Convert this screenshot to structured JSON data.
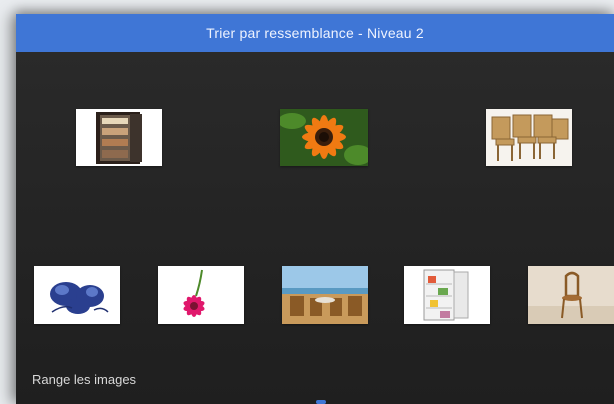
{
  "window": {
    "title": "Trier par ressemblance - Niveau 2"
  },
  "instruction": "Range les images",
  "categories": [
    {
      "id": "category-fridge",
      "icon": "open-fridge-image"
    },
    {
      "id": "category-flower",
      "icon": "orange-flower-image"
    },
    {
      "id": "category-chairs",
      "icon": "wooden-chairs-image"
    }
  ],
  "tray": [
    {
      "id": "tray-blue-flowers",
      "icon": "blue-flowers-image"
    },
    {
      "id": "tray-pink-flower",
      "icon": "pink-flower-image"
    },
    {
      "id": "tray-terrace-chairs",
      "icon": "terrace-chairs-image"
    },
    {
      "id": "tray-fridge",
      "icon": "white-fridge-image"
    },
    {
      "id": "tray-wooden-chair",
      "icon": "wooden-chair-image"
    }
  ],
  "colors": {
    "accent": "#3f76d6",
    "background": "#262626",
    "text": "#d8d8d8"
  }
}
